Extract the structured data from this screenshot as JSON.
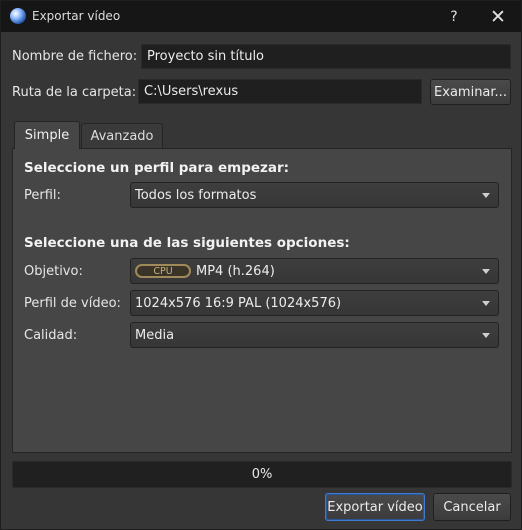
{
  "window": {
    "title": "Exportar vídeo",
    "help_label": "?",
    "close_label": "✕"
  },
  "file": {
    "name_label": "Nombre de fichero:",
    "name_value": "Proyecto sin título",
    "folder_label": "Ruta de la carpeta:",
    "folder_value": "C:\\Users\\rexus",
    "browse_label": "Examinar..."
  },
  "tabs": [
    {
      "label": "Simple",
      "active": true
    },
    {
      "label": "Avanzado",
      "active": false
    }
  ],
  "simple": {
    "profile_section_title": "Seleccione un perfil para empezar:",
    "profile_label": "Perfil:",
    "profile_value": "Todos los formatos",
    "options_section_title": "Seleccione una de las siguientes opciones:",
    "target_label": "Objetivo:",
    "target_badge": "CPU",
    "target_value": "MP4 (h.264)",
    "video_profile_label": "Perfil de vídeo:",
    "video_profile_value": "1024x576 16:9 PAL (1024x576)",
    "quality_label": "Calidad:",
    "quality_value": "Media"
  },
  "progress": {
    "value": 0,
    "text": "0%"
  },
  "footer": {
    "export_label": "Exportar vídeo",
    "cancel_label": "Cancelar"
  },
  "colors": {
    "accent": "#3e7bd1",
    "badge": "#c9b27d"
  }
}
